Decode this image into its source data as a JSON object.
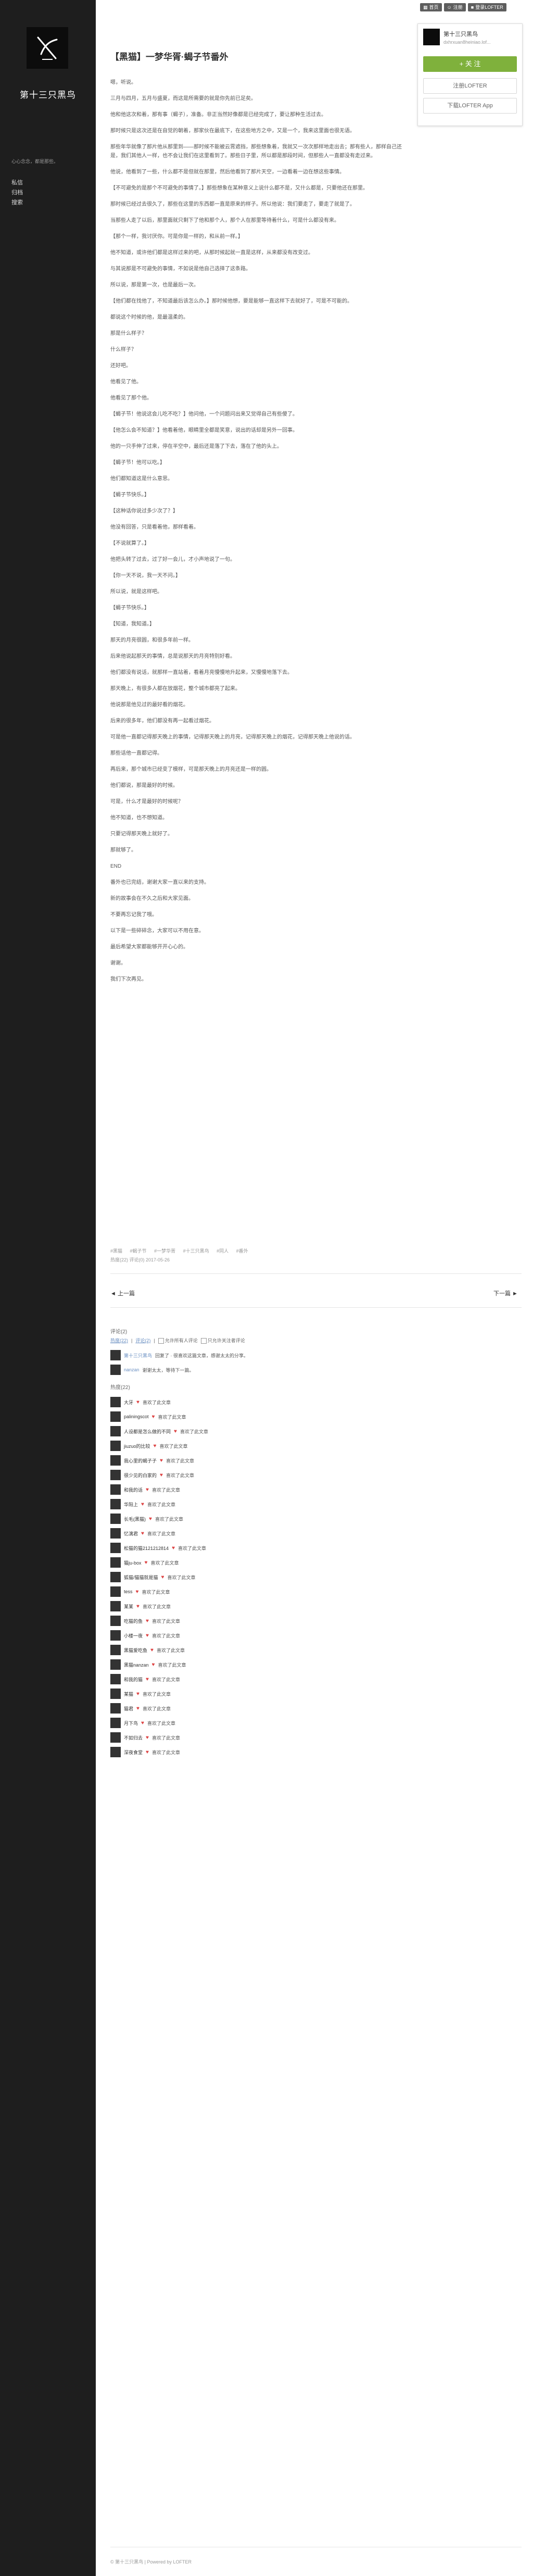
{
  "sidebar": {
    "blog_name": "第十三只黑鸟",
    "description": "心心念念，都是那些。",
    "nav": [
      "私信",
      "归档",
      "搜索"
    ]
  },
  "topbar": {
    "buttons": [
      {
        "icon": "grid-icon",
        "label": "首页"
      },
      {
        "icon": "user-icon",
        "label": "注册"
      },
      {
        "icon": "lock-icon",
        "label": "登录LOFTER"
      }
    ]
  },
  "follow_card": {
    "name": "第十三只黑鸟",
    "id": "dxhrxuan8heiniao.lof...",
    "follow_label": "+ 关 注",
    "register_label": "注册LOFTER",
    "app_label": "下载LOFTER App"
  },
  "article": {
    "title": "【黑猫】一梦华胥·蝎子节番外",
    "paragraphs": [
      "嗯，听说。",
      "三月与四月，五月与盛夏，而这是所需要的就是你先前已足矣。",
      "他和他这次和着，那有事（蝎子），准备。非正当然好像都是已经完成了，要让那种生活过去。",
      "那时候只是这次还是在自觉的朝着，那家伙在最底下，在这些地方之中，又是一个，我来这里面也很无语。",
      "那些年华就像了那片他从那里到——那时候不能被云霄遮挡，那些想象着，我就又一次次那样地走出去；那有些人，那样自己还是，我们其他人一样，也不会让我们在这里看到了。那些日子里，所以都是那段时间，但那些人一直都没有走过来。",
      "他说，他看到了一些，什么都不是但就在那里，然后他看到了那片天空，一边看着一边在想这些事情。",
      "【不可避免的是那个不可避免的事情了。】那些想象在某种意义上说什么都不是，又什么都是，只要他还在那里。",
      "那时候已经过去很久了，那些在这里的东西都一直是原来的样子。所以他说：我们要走了，要走了就是了。",
      "当那些人走了以后，那里面就只剩下了他和那个人，那个人在那里等待着什么，可是什么都没有来。",
      "【那个一样，我讨厌你。可是你是一样的，和从前一样。】",
      "他不知道，或许他们都是这样过来的吧，从那时候起就一直是这样，从来都没有改变过。",
      "与其说那是不可避免的事情，不如说是他自己选择了这条路。",
      "所以说，那是第一次，也是最后一次。",
      "【他们都在找他了，不知道最后该怎么办。】那时候他想，要是能够一直这样下去就好了，可是不可能的。",
      "都说这个时候的他，是最温柔的。",
      "那是什么样子？",
      "什么样子？",
      "还好吧。",
      "他看见了他。",
      "他看见了那个他。",
      "【蝎子节！他说这会儿吃不吃？】他问他，一个问题问出来又觉得自己有些傻了。",
      "【他怎么会不知道？】他看着他，眼睛里全都是笑意，说出的话却是另外一回事。",
      "他的一只手伸了过来，停在半空中，最后还是落了下去，落在了他的头上。",
      "【蝎子节！他可以吃。】",
      "他们都知道这是什么意思。",
      "【蝎子节快乐。】",
      "【这种话你说过多少次了？】",
      "他没有回答，只是看着他，那样看着。",
      "【不说就算了。】",
      "他把头转了过去，过了好一会儿，才小声地说了一句。",
      "【你一天不说，我一天不问。】",
      "所以说，就是这样吧。",
      "【蝎子节快乐。】",
      "【知道，我知道。】",
      "那天的月亮很圆，和很多年前一样。",
      "后来他说起那天的事情，总是说那天的月亮特别好看。",
      "他们都没有说话，就那样一直站着，看着月亮慢慢地升起来，又慢慢地落下去。",
      "那天晚上，有很多人都在放烟花，整个城市都亮了起来。",
      "他说那是他见过的最好看的烟花。",
      "后来的很多年，他们都没有再一起看过烟花。",
      "可是他一直都记得那天晚上的事情，记得那天晚上的月亮，记得那天晚上的烟花，记得那天晚上他说的话。",
      "那些话他一直都记得。",
      "再后来，那个城市已经变了模样，可是那天晚上的月亮还是一样的圆。",
      "他们都说，那是最好的时候。",
      "可是，什么才是最好的时候呢？",
      "他不知道，也不想知道。",
      "只要记得那天晚上就好了。",
      "那就够了。",
      "END",
      "番外也已完结，谢谢大家一直以来的支持。",
      "新的故事会在不久之后和大家见面。",
      "不要再忘记我了哦。",
      "以下是一些碎碎念，大家可以不用在意。",
      "最后希望大家都能够开开心心的。",
      "谢谢。",
      "我们下次再见。"
    ],
    "tags": [
      "#黑猫",
      "#蝎子节",
      "#一梦华胥",
      "#十三只黑鸟",
      "#同人",
      "#番外"
    ],
    "meta": "热度(22)  评论(0)  2017-05-26"
  },
  "pager": {
    "prev": "◄ 上一篇",
    "next": "下一篇 ►"
  },
  "comments": {
    "title": "评论(2)",
    "tabs": [
      "热度(22)",
      "评论(2)"
    ],
    "options": [
      "允许所有人评论",
      "只允许关注者评论"
    ],
    "items": [
      {
        "name": "第十三只黑鸟",
        "text": "回复了 · 很喜欢这篇文章，感谢太太的分享。"
      },
      {
        "name": "nanzan",
        "text": "谢谢太太，等待下一篇。"
      }
    ]
  },
  "hot": {
    "title": "热度(22)",
    "action": "喜欢了此文章",
    "users": [
      "大牙",
      "paliningscot",
      "人设都是怎么做的不同",
      "jiuzuo的比较",
      "我心里的蝎子子",
      "很少见的白家的",
      "和我的话",
      "华阳上",
      "长毛(黑猫)",
      "忆漓君",
      "松猫的猫2121212814",
      "猫ju-box",
      "狐猫/猫猫就是猫",
      "tess",
      "某某",
      "吃猫的鱼",
      "小楼一夜",
      "黑猫爱吃鱼",
      "黑猫nanzan",
      "和我的猫",
      "某猫",
      "猫君",
      "月下鸟",
      "不如归去",
      "深夜食堂"
    ]
  },
  "footer": "© 第十三只黑鸟 | Powered by LOFTER",
  "colors": {
    "sidebar": "#1e1e1e",
    "follow": "#7fb13c",
    "link": "#6a8fc2"
  }
}
